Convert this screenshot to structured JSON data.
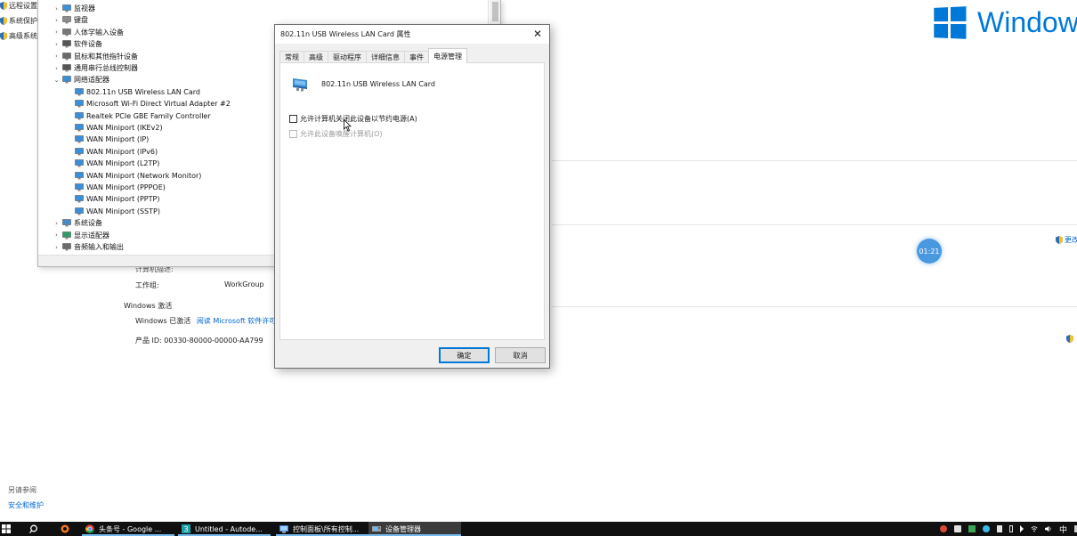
{
  "background": {
    "left_nav": [
      {
        "label": "远程设置"
      },
      {
        "label": "系统保护"
      },
      {
        "label": "高级系统"
      }
    ],
    "windows_brand": "Window",
    "workgroup_label": "工作组:",
    "workgroup_value": "WorkGroup",
    "computer_desc_label": "计算机描述:",
    "activation_section": "Windows 激活",
    "activation_status": "Windows 已激活",
    "activation_link": "阅读 Microsoft 软件许可",
    "product_id": "产品 ID: 00330-80000-00000-AA799",
    "change_settings": "更改",
    "see_also": "另请参阅",
    "security_maintenance": "安全和维护",
    "timer": "01:21"
  },
  "device_manager": {
    "tree": [
      {
        "label": "监视器",
        "level": 0,
        "expander": "›",
        "icon": "monitor-icon"
      },
      {
        "label": "键盘",
        "level": 0,
        "expander": "›",
        "icon": "keyboard-icon"
      },
      {
        "label": "人体学输入设备",
        "level": 0,
        "expander": "›",
        "icon": "hid-icon"
      },
      {
        "label": "软件设备",
        "level": 0,
        "expander": "›",
        "icon": "software-device-icon"
      },
      {
        "label": "鼠标和其他指针设备",
        "level": 0,
        "expander": "›",
        "icon": "mouse-icon"
      },
      {
        "label": "通用串行总线控制器",
        "level": 0,
        "expander": "›",
        "icon": "usb-icon"
      },
      {
        "label": "网络适配器",
        "level": 0,
        "expander": "⌄",
        "icon": "network-adapter-icon"
      },
      {
        "label": "802.11n USB Wireless LAN Card",
        "level": 1,
        "icon": "network-adapter-icon"
      },
      {
        "label": "Microsoft Wi-Fi Direct Virtual Adapter #2",
        "level": 1,
        "icon": "network-adapter-icon"
      },
      {
        "label": "Realtek PCIe GBE Family Controller",
        "level": 1,
        "icon": "network-adapter-icon"
      },
      {
        "label": "WAN Miniport (IKEv2)",
        "level": 1,
        "icon": "network-adapter-icon"
      },
      {
        "label": "WAN Miniport (IP)",
        "level": 1,
        "icon": "network-adapter-icon"
      },
      {
        "label": "WAN Miniport (IPv6)",
        "level": 1,
        "icon": "network-adapter-icon"
      },
      {
        "label": "WAN Miniport (L2TP)",
        "level": 1,
        "icon": "network-adapter-icon"
      },
      {
        "label": "WAN Miniport (Network Monitor)",
        "level": 1,
        "icon": "network-adapter-icon"
      },
      {
        "label": "WAN Miniport (PPPOE)",
        "level": 1,
        "icon": "network-adapter-icon"
      },
      {
        "label": "WAN Miniport (PPTP)",
        "level": 1,
        "icon": "network-adapter-icon"
      },
      {
        "label": "WAN Miniport (SSTP)",
        "level": 1,
        "icon": "network-adapter-icon"
      },
      {
        "label": "系统设备",
        "level": 0,
        "expander": "›",
        "icon": "system-device-icon"
      },
      {
        "label": "显示适配器",
        "level": 0,
        "expander": "›",
        "icon": "display-adapter-icon"
      },
      {
        "label": "音频输入和输出",
        "level": 0,
        "expander": "›",
        "icon": "audio-icon"
      }
    ]
  },
  "dialog": {
    "title": "802.11n USB Wireless LAN Card 属性",
    "tabs": [
      {
        "label": "常规"
      },
      {
        "label": "高级"
      },
      {
        "label": "驱动程序"
      },
      {
        "label": "详细信息"
      },
      {
        "label": "事件"
      },
      {
        "label": "电源管理"
      }
    ],
    "active_tab": "电源管理",
    "device_name": "802.11n USB Wireless LAN Card",
    "option_power_off": "允许计算机关闭此设备以节约电源(A)",
    "option_wake": "允许此设备唤醒计算机(O)",
    "ok": "确定",
    "cancel": "取消"
  },
  "taskbar": {
    "apps": [
      {
        "label": "头条号 - Google ..."
      },
      {
        "label": "Untitled - Autode..."
      },
      {
        "label": "控制面板\\所有控制..."
      },
      {
        "label": "设备管理器"
      }
    ],
    "ime": "中"
  },
  "colors": {
    "accent": "#0078d7",
    "link": "#0066cc",
    "taskbar": "#101010",
    "timer_bubble": "#4a98e0"
  }
}
